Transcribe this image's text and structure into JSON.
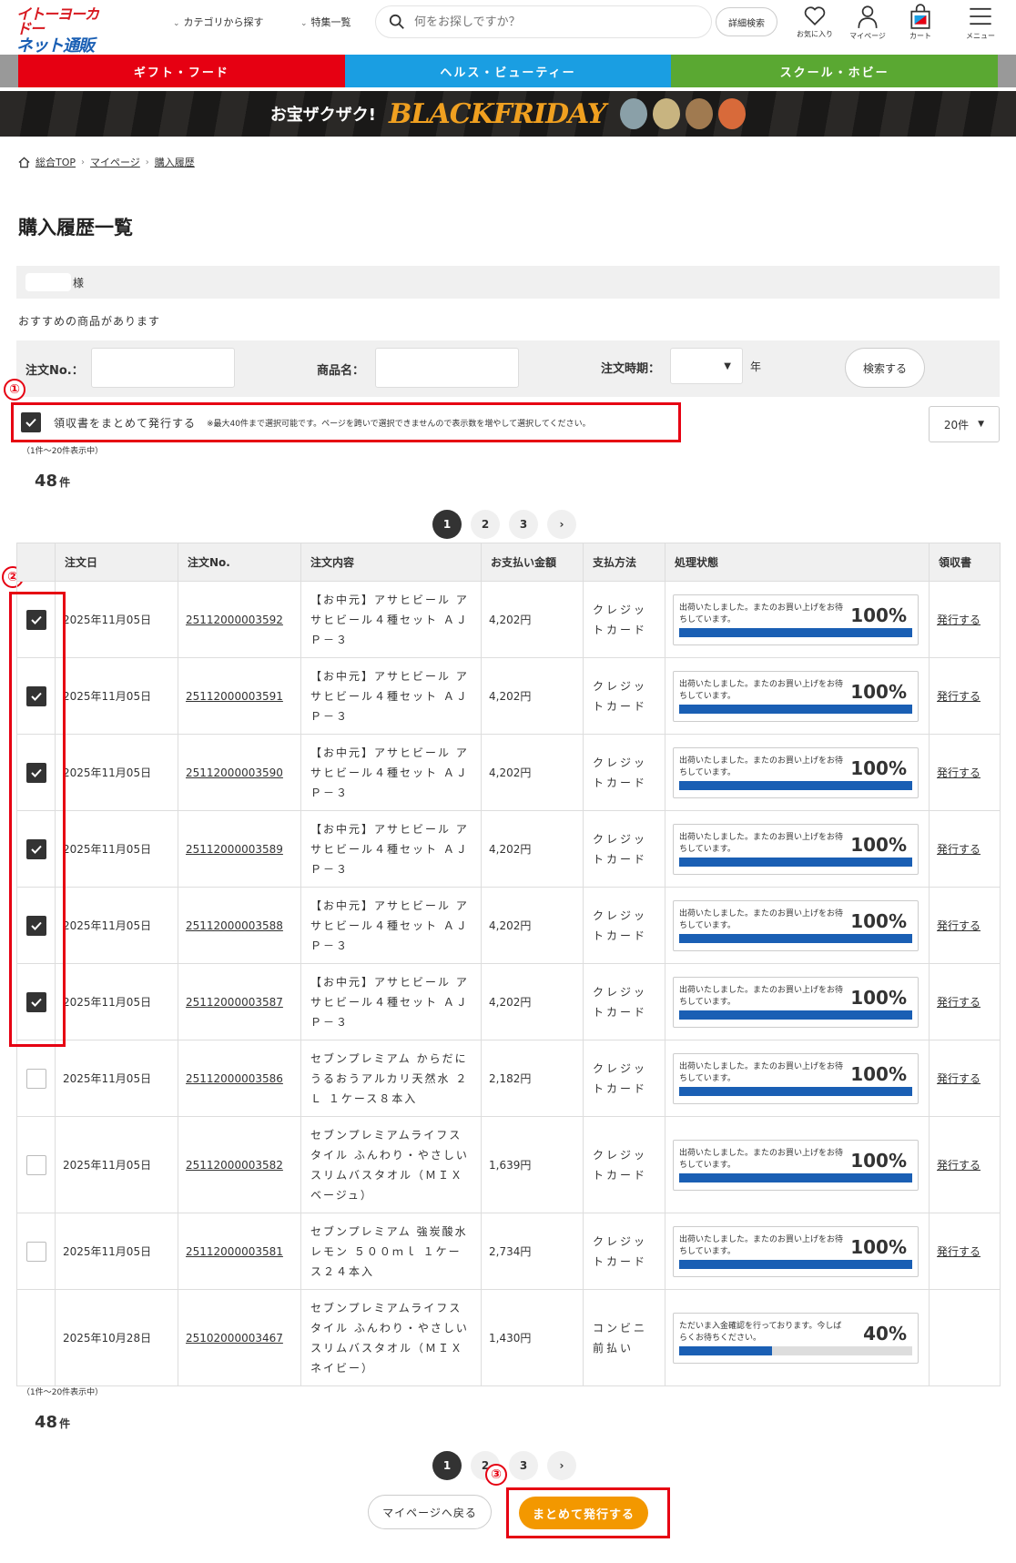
{
  "header": {
    "logo_line1": "イトーヨーカドー",
    "logo_line2": "ネット通販",
    "nav_category": "カテゴリから探す",
    "nav_features": "特集一覧",
    "search_placeholder": "何をお探しですか？",
    "advanced_search": "詳細検索",
    "favorites": "お気に入り",
    "mypage": "マイページ",
    "cart": "カート",
    "menu": "メニュー"
  },
  "categories": [
    {
      "label": "ギフト・フード",
      "color": "#e60012"
    },
    {
      "label": "ヘルス・ビューティー",
      "color": "#1a9ee2"
    },
    {
      "label": "スクール・ホビー",
      "color": "#5aa832"
    }
  ],
  "banner": {
    "text": "お宝ザクザク!",
    "brand": "BLACKFRIDAY"
  },
  "breadcrumb": [
    "総合TOP",
    "マイページ",
    "購入履歴"
  ],
  "page_title": "購入履歴一覧",
  "user_suffix": "様",
  "recommend_text": "おすすめの商品があります",
  "search_form": {
    "order_no_label": "注文No.：",
    "product_label": "商品名：",
    "period_label": "注文時期：",
    "year_suffix": "年",
    "search_button": "検索する"
  },
  "bulk": {
    "label": "領収書をまとめて発行する",
    "note": "※最大40件まで選択可能です。ページを跨いで選択できませんので表示数を増やして選択してください。",
    "per_page": "20件"
  },
  "range_text": "（1件～20件表示中）",
  "total_count": "48",
  "count_unit": "件",
  "pager": {
    "pages": [
      "1",
      "2",
      "3"
    ],
    "current": "1",
    "next": "›"
  },
  "table": {
    "headers": [
      "",
      "注文日",
      "注文No.",
      "注文内容",
      "お支払い金額",
      "支払方法",
      "処理状態",
      "領収書"
    ],
    "rows": [
      {
        "checked": true,
        "date": "2025年11月05日",
        "order_no": "25112000003592",
        "content": "【お中元】アサヒビール アサヒビール４種セット ＡＪＰ－３",
        "amount": "4,202円",
        "payment": "クレジットカード",
        "status_text": "出荷いたしました。またのお買い上げをお待ちしています。",
        "progress": 100,
        "progress_label": "100%",
        "receipt": "発行する"
      },
      {
        "checked": true,
        "date": "2025年11月05日",
        "order_no": "25112000003591",
        "content": "【お中元】アサヒビール アサヒビール４種セット ＡＪＰ－３",
        "amount": "4,202円",
        "payment": "クレジットカード",
        "status_text": "出荷いたしました。またのお買い上げをお待ちしています。",
        "progress": 100,
        "progress_label": "100%",
        "receipt": "発行する"
      },
      {
        "checked": true,
        "date": "2025年11月05日",
        "order_no": "25112000003590",
        "content": "【お中元】アサヒビール アサヒビール４種セット ＡＪＰ－３",
        "amount": "4,202円",
        "payment": "クレジットカード",
        "status_text": "出荷いたしました。またのお買い上げをお待ちしています。",
        "progress": 100,
        "progress_label": "100%",
        "receipt": "発行する"
      },
      {
        "checked": true,
        "date": "2025年11月05日",
        "order_no": "25112000003589",
        "content": "【お中元】アサヒビール アサヒビール４種セット ＡＪＰ－３",
        "amount": "4,202円",
        "payment": "クレジットカード",
        "status_text": "出荷いたしました。またのお買い上げをお待ちしています。",
        "progress": 100,
        "progress_label": "100%",
        "receipt": "発行する"
      },
      {
        "checked": true,
        "date": "2025年11月05日",
        "order_no": "25112000003588",
        "content": "【お中元】アサヒビール アサヒビール４種セット ＡＪＰ－３",
        "amount": "4,202円",
        "payment": "クレジットカード",
        "status_text": "出荷いたしました。またのお買い上げをお待ちしています。",
        "progress": 100,
        "progress_label": "100%",
        "receipt": "発行する"
      },
      {
        "checked": true,
        "date": "2025年11月05日",
        "order_no": "25112000003587",
        "content": "【お中元】アサヒビール アサヒビール４種セット ＡＪＰ－３",
        "amount": "4,202円",
        "payment": "クレジットカード",
        "status_text": "出荷いたしました。またのお買い上げをお待ちしています。",
        "progress": 100,
        "progress_label": "100%",
        "receipt": "発行する"
      },
      {
        "checked": false,
        "date": "2025年11月05日",
        "order_no": "25112000003586",
        "content": "セブンプレミアム からだにうるおうアルカリ天然水 ２Ｌ １ケース８本入",
        "amount": "2,182円",
        "payment": "クレジットカード",
        "status_text": "出荷いたしました。またのお買い上げをお待ちしています。",
        "progress": 100,
        "progress_label": "100%",
        "receipt": "発行する"
      },
      {
        "checked": false,
        "date": "2025年11月05日",
        "order_no": "25112000003582",
        "content": "セブンプレミアムライフスタイル ふんわり・やさしい スリムバスタオル（ＭＩＸベージュ）",
        "amount": "1,639円",
        "payment": "クレジットカード",
        "status_text": "出荷いたしました。またのお買い上げをお待ちしています。",
        "progress": 100,
        "progress_label": "100%",
        "receipt": "発行する"
      },
      {
        "checked": false,
        "date": "2025年11月05日",
        "order_no": "25112000003581",
        "content": "セブンプレミアム 強炭酸水レモン ５００ｍｌ １ケース２４本入",
        "amount": "2,734円",
        "payment": "クレジットカード",
        "status_text": "出荷いたしました。またのお買い上げをお待ちしています。",
        "progress": 100,
        "progress_label": "100%",
        "receipt": "発行する"
      },
      {
        "checked": null,
        "date": "2025年10月28日",
        "order_no": "25102000003467",
        "content": "セブンプレミアムライフスタイル ふんわり・やさしい スリムバスタオル（ＭＩＸネイビー）",
        "amount": "1,430円",
        "payment": "コンビニ前払い",
        "status_text": "ただいま入金確認を行っております。今しばらくお待ちください。",
        "progress": 40,
        "progress_label": "40%",
        "receipt": ""
      }
    ]
  },
  "annotations": [
    "①",
    "②",
    "③"
  ],
  "footer": {
    "back_button": "マイページへ戻る",
    "bulk_issue_button": "まとめて発行する"
  }
}
